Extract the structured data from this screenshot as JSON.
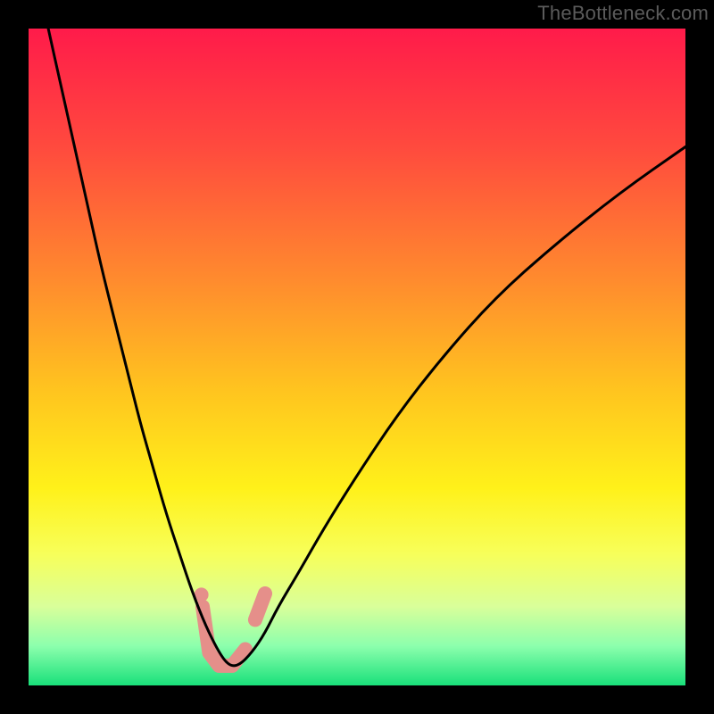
{
  "watermark": "TheBottleneck.com",
  "chart_data": {
    "type": "line",
    "title": "",
    "xlabel": "",
    "ylabel": "",
    "xlim": [
      0,
      100
    ],
    "ylim": [
      0,
      100
    ],
    "grid": false,
    "legend": false,
    "background_gradient": {
      "stops": [
        {
          "offset": 0.0,
          "color": "#ff1b4a"
        },
        {
          "offset": 0.18,
          "color": "#ff4a3e"
        },
        {
          "offset": 0.38,
          "color": "#ff8a2e"
        },
        {
          "offset": 0.55,
          "color": "#ffc41f"
        },
        {
          "offset": 0.7,
          "color": "#fff11a"
        },
        {
          "offset": 0.8,
          "color": "#f7ff5a"
        },
        {
          "offset": 0.88,
          "color": "#d9ff9a"
        },
        {
          "offset": 0.94,
          "color": "#8cffad"
        },
        {
          "offset": 1.0,
          "color": "#19e07a"
        }
      ]
    },
    "series": [
      {
        "name": "bottleneck-curve",
        "color": "#000000",
        "stroke_width": 3,
        "x": [
          3,
          5,
          7,
          9,
          11,
          13,
          15,
          17,
          19,
          21,
          23,
          25,
          27,
          29,
          30.5,
          32,
          34,
          36,
          38,
          41,
          45,
          50,
          56,
          63,
          71,
          80,
          90,
          100
        ],
        "y": [
          100,
          91,
          82,
          73,
          64,
          56,
          48,
          40,
          33,
          26,
          20,
          14,
          9,
          5,
          3,
          3,
          5,
          8,
          12,
          17,
          24,
          32,
          41,
          50,
          59,
          67,
          75,
          82
        ]
      }
    ],
    "annotations": {
      "valley_highlight": {
        "color": "#e58f8a",
        "stroke_width": 16,
        "linecap": "round",
        "segments": [
          {
            "x": [
              26.5,
              27.5,
              29.0,
              31.0,
              33.0
            ],
            "y": [
              12.0,
              5.0,
              3.0,
              3.0,
              5.5
            ]
          },
          {
            "x": [
              34.5,
              36.0
            ],
            "y": [
              10.0,
              14.0
            ]
          }
        ],
        "dots": [
          {
            "x": 26.3,
            "y": 13.8,
            "r": 8
          }
        ]
      }
    }
  }
}
